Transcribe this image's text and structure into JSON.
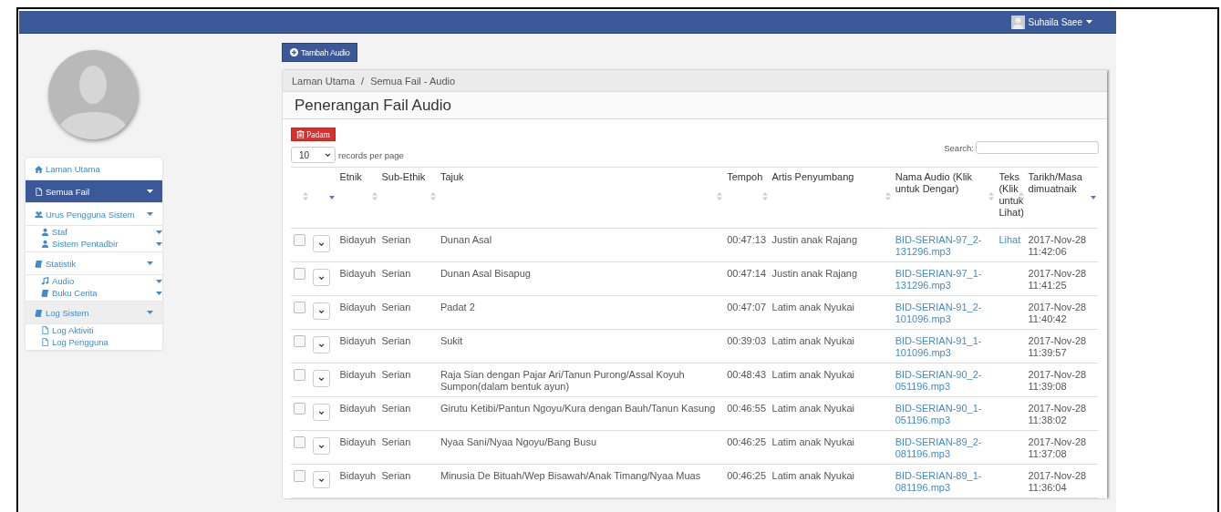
{
  "top_bar": {
    "user_name": "Suhaila Saee"
  },
  "sidebar": {
    "items": [
      {
        "label": "Laman Utama",
        "kind": "home",
        "selected": false,
        "highlighted": false,
        "caret": false
      },
      {
        "label": "Semua Fail",
        "kind": "file",
        "selected": true,
        "highlighted": false,
        "caret": true
      },
      {
        "label": "Urus Pengguna Sistem",
        "kind": "users",
        "selected": false,
        "highlighted": false,
        "caret": true,
        "children": [
          {
            "label": "Staf",
            "kind": "user",
            "caret": true
          },
          {
            "label": "Sistem Pentadbir",
            "kind": "user",
            "caret": true
          }
        ]
      },
      {
        "label": "Statistik",
        "kind": "book",
        "selected": false,
        "highlighted": false,
        "caret": true,
        "children": [
          {
            "label": "Audio",
            "kind": "music",
            "caret": true
          },
          {
            "label": "Buku Cerita",
            "kind": "book",
            "caret": true
          }
        ]
      },
      {
        "label": "Log Sistem",
        "kind": "book",
        "selected": false,
        "highlighted": true,
        "caret": true,
        "children": [
          {
            "label": "Log Aktiviti",
            "kind": "file",
            "caret": false
          },
          {
            "label": "Log Pengguna",
            "kind": "file",
            "caret": false
          }
        ]
      }
    ]
  },
  "add_button": "Tambah Audio",
  "breadcrumb": [
    "Laman Utama",
    "Semua Fail - Audio"
  ],
  "breadcrumb_separator": "/",
  "page_title": "Penerangan Fail Audio",
  "delete_button": "Padam",
  "page_size": {
    "value": "10",
    "label": "records per page"
  },
  "search": {
    "label": "Search:"
  },
  "table": {
    "columns": [
      {
        "kind": "check",
        "sorted_descending": false
      },
      {
        "kind": "select",
        "sorted_descending": true
      },
      {
        "label": "Etnik",
        "kind": "text",
        "sorted_descending": false
      },
      {
        "label": "Sub-Ethik",
        "kind": "text",
        "sorted_descending": false
      },
      {
        "label": "Tajuk",
        "kind": "text",
        "sorted_descending": false
      },
      {
        "label": "Tempoh",
        "kind": "text",
        "sorted_descending": false
      },
      {
        "label": "Artis Penyumbang",
        "kind": "text",
        "sorted_descending": false
      },
      {
        "label": "Nama Audio (Klik untuk Dengar)",
        "kind": "link",
        "sorted_descending": false
      },
      {
        "label": "Teks (Klik untuk Lihat)",
        "kind": "link",
        "sorted_descending": false
      },
      {
        "label": "Tarikh/Masa dimuatnaik",
        "kind": "text",
        "sorted_descending": true
      }
    ],
    "rows": [
      {
        "checked": false,
        "cells": [
          null,
          null,
          "Bidayuh",
          "Serian",
          "Dunan Asal",
          "00:47:13",
          "Justin anak Rajang",
          "BID-SERIAN-97_2-131296.mp3",
          "Lihat",
          "2017-Nov-28 11:42:06"
        ]
      },
      {
        "checked": false,
        "cells": [
          null,
          null,
          "Bidayuh",
          "Serian",
          "Dunan Asal Bisapug",
          "00:47:14",
          "Justin anak Rajang",
          "BID-SERIAN-97_1-131296.mp3",
          null,
          "2017-Nov-28 11:41:25"
        ]
      },
      {
        "checked": false,
        "cells": [
          null,
          null,
          "Bidayuh",
          "Serian",
          "Padat 2",
          "00:47:07",
          "Latim anak Nyukai",
          "BID-SERIAN-91_2-101096.mp3",
          null,
          "2017-Nov-28 11:40:42"
        ]
      },
      {
        "checked": false,
        "cells": [
          null,
          null,
          "Bidayuh",
          "Serian",
          "Sukit",
          "00:39:03",
          "Latim anak Nyukai",
          "BID-SERIAN-91_1-101096.mp3",
          null,
          "2017-Nov-28 11:39:57"
        ]
      },
      {
        "checked": false,
        "cells": [
          null,
          null,
          "Bidayuh",
          "Serian",
          "Raja Sian dengan Pajar Ari/Tanun Purong/Assal Koyuh Sumpon(dalam bentuk ayun)",
          "00:48:43",
          "Latim anak Nyukai",
          "BID-SERIAN-90_2-051196.mp3",
          null,
          "2017-Nov-28 11:39:08"
        ]
      },
      {
        "checked": false,
        "cells": [
          null,
          null,
          "Bidayuh",
          "Serian",
          "Girutu Ketibi/Pantun Ngoyu/Kura dengan Bauh/Tanun Kasung",
          "00:46:55",
          "Latim anak Nyukai",
          "BID-SERIAN-90_1-051196.mp3",
          null,
          "2017-Nov-28 11:38:02"
        ]
      },
      {
        "checked": false,
        "cells": [
          null,
          null,
          "Bidayuh",
          "Serian",
          "Nyaa Sani/Nyaa Ngoyu/Bang Busu",
          "00:46:25",
          "Latim anak Nyukai",
          "BID-SERIAN-89_2-081196.mp3",
          null,
          "2017-Nov-28 11:37:08"
        ]
      },
      {
        "checked": false,
        "cells": [
          null,
          null,
          "Bidayuh",
          "Serian",
          "Minusia De Bituah/Wep Bisawah/Anak Timang/Nyaa Muas",
          "00:46:25",
          "Latim anak Nyukai",
          "BID-SERIAN-89_1-081196.mp3",
          null,
          "2017-Nov-28 11:36:04"
        ]
      }
    ]
  }
}
